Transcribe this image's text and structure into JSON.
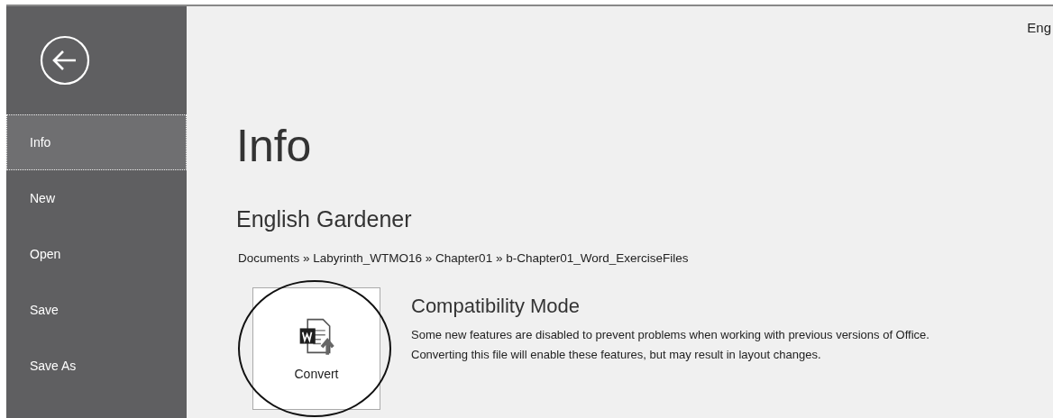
{
  "sidebar": {
    "items": [
      {
        "label": "Info",
        "selected": true
      },
      {
        "label": "New",
        "selected": false
      },
      {
        "label": "Open",
        "selected": false
      },
      {
        "label": "Save",
        "selected": false
      },
      {
        "label": "Save As",
        "selected": false
      }
    ]
  },
  "header": {
    "account": "Eng"
  },
  "page": {
    "title": "Info",
    "document_name": "English Gardener",
    "path": "Documents » Labyrinth_WTMO16 » Chapter01 » b-Chapter01_Word_ExerciseFiles"
  },
  "compatibility": {
    "button": "Convert",
    "heading": "Compatibility Mode",
    "description": "Some new features are disabled to prevent problems when working with previous versions of Office. Converting this file will enable these features, but may result in layout changes."
  }
}
